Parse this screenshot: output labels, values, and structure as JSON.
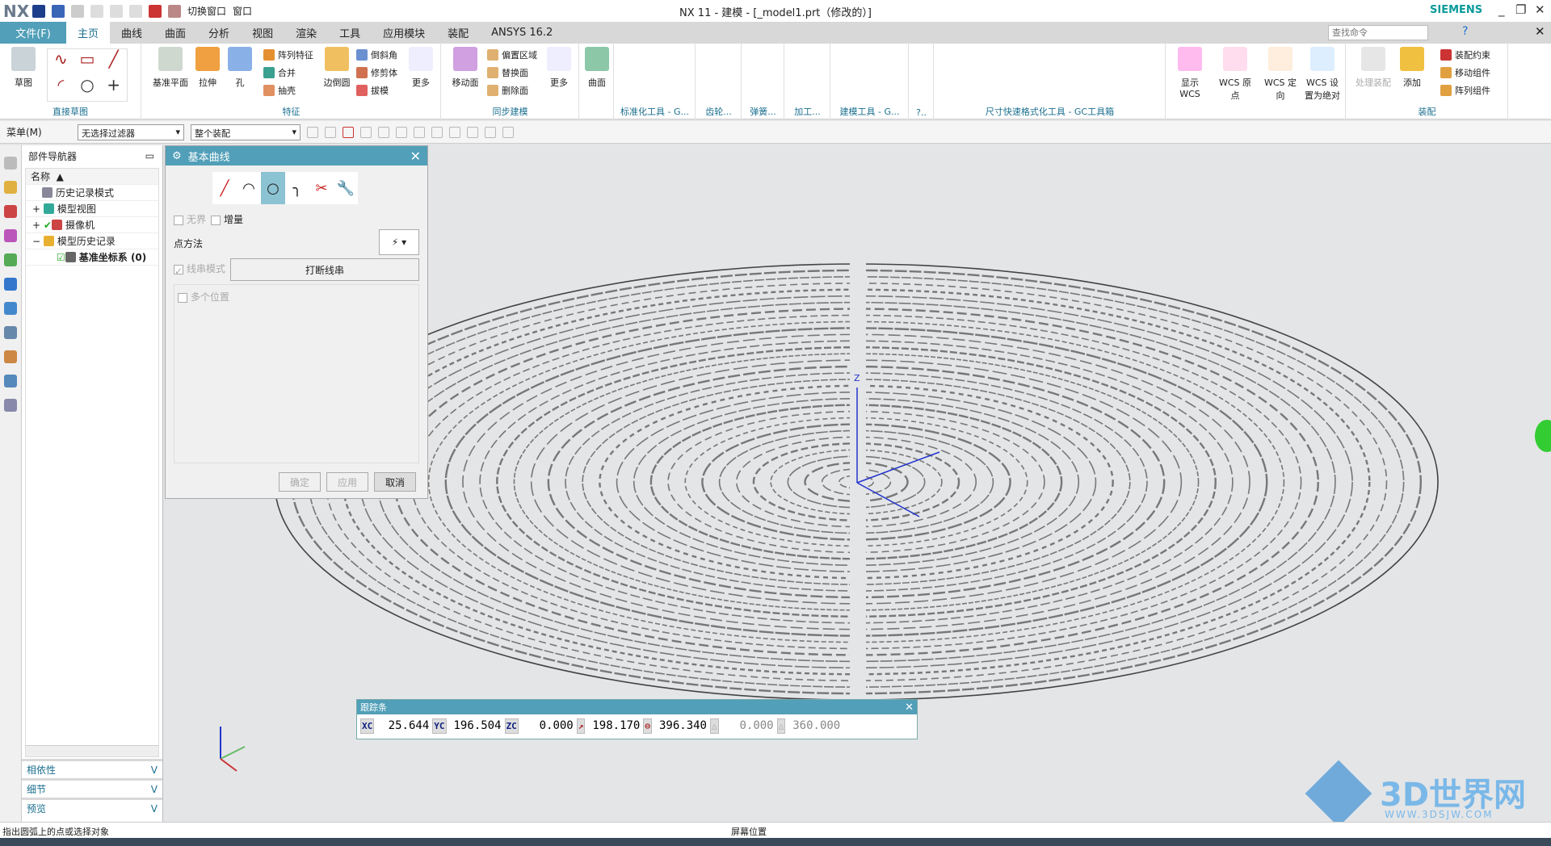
{
  "titlebar": {
    "logo": "NX",
    "quick": [
      "切换窗口",
      "窗口"
    ],
    "title": "NX 11 - 建模 - [_model1.prt（修改的）]",
    "brand": "SIEMENS"
  },
  "tabs": {
    "file": "文件(F)",
    "items": [
      "主页",
      "曲线",
      "曲面",
      "分析",
      "视图",
      "渲染",
      "工具",
      "应用模块",
      "装配",
      "ANSYS 16.2"
    ],
    "active": "主页",
    "search_placeholder": "查找命令"
  },
  "ribbon": {
    "sketch": {
      "label": "直接草图",
      "btn": "草图"
    },
    "feature": {
      "label": "特征",
      "big": [
        "基准平面",
        "拉伸",
        "孔",
        "边倒圆",
        "更多"
      ],
      "small": [
        "阵列特征",
        "合并",
        "抽壳",
        "倒斜角",
        "修剪体",
        "拔模"
      ]
    },
    "sync": {
      "label": "同步建模",
      "big": [
        "移动面",
        "更多"
      ],
      "small": [
        "偏置区域",
        "替换面",
        "删除面"
      ]
    },
    "surface": {
      "btn": "曲面"
    },
    "groups": [
      "标准化工具 - G...",
      "齿轮...",
      "弹簧...",
      "加工...",
      "建模工具 - G...",
      "?..",
      "尺寸快速格式化工具 - GC工具箱"
    ],
    "wcs": [
      "显示 WCS",
      "WCS 原点",
      "WCS 定向",
      "WCS 设置为绝对"
    ],
    "assembly": {
      "label": "装配",
      "big": [
        "处理装配",
        "添加"
      ],
      "small": [
        "装配约束",
        "移动组件",
        "阵列组件"
      ]
    }
  },
  "toolbar": {
    "menu": "菜单(M)",
    "filter": "无选择过滤器",
    "scope": "整个装配"
  },
  "navigator": {
    "title": "部件导航器",
    "column": "名称",
    "items": [
      "历史记录模式",
      "模型视图",
      "摄像机",
      "模型历史记录",
      "基准坐标系 (0)"
    ],
    "panels": [
      "相依性",
      "细节",
      "预览"
    ]
  },
  "dialog": {
    "title": "基本曲线",
    "unbounded": "无界",
    "incremental": "增量",
    "point_method": "点方法",
    "string_mode": "线串模式",
    "break_string": "打断线串",
    "multi_position": "多个位置",
    "ok": "确定",
    "apply": "应用",
    "cancel": "取消"
  },
  "trackbar": {
    "title": "跟踪条",
    "labels": [
      "XC",
      "YC",
      "ZC"
    ],
    "values": [
      "25.644",
      "196.504",
      "0.000",
      "198.170",
      "396.340",
      "0.000",
      "360.000"
    ]
  },
  "status": {
    "left": "指出圆弧上的点或选择对象",
    "center": "屏幕位置"
  },
  "watermark": {
    "text": "3D世界网",
    "url": "WWW.3DSJW.COM"
  },
  "colors": {
    "accent": "#519fb8",
    "tab_active": "#1a6f8f"
  }
}
